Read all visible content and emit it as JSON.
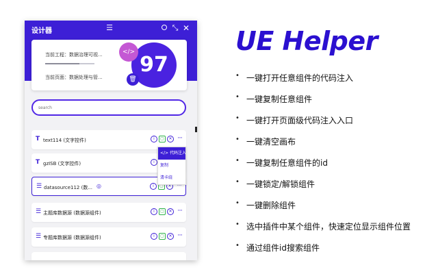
{
  "panel": {
    "title": "设计器",
    "icons": {
      "menu": "menu-icon",
      "circle": "circle-icon",
      "shrink": "shrink-icon",
      "close": "close-icon"
    },
    "info": {
      "project_label": "当前工程：数据治理可视...",
      "page_label": "当前页面：数据处理与管...",
      "progress": 0.7
    },
    "score": "97",
    "search_placeholder": "search",
    "components": [
      {
        "icon": "T",
        "label": "text114 (文字控件)"
      },
      {
        "icon": "T",
        "label": "gzISB (文字控件)"
      },
      {
        "icon": "database",
        "label": "datasource112 (数...",
        "selected": true
      },
      {
        "icon": "database",
        "label": "主题库数据源 (数据源组件)"
      },
      {
        "icon": "database",
        "label": "专题库数据源 (数据源组件)"
      }
    ],
    "context_menu": [
      "</> 代码注入",
      "复制",
      "清卡绕"
    ],
    "accent_color": "#3d1fd6"
  },
  "title": "UE Helper",
  "features": [
    "一键打开任意组件的代码注入",
    "一键复制任意组件",
    "一键打开页面级代码注入入口",
    "一键清空画布",
    "一键复制任意组件的id",
    "一键锁定/解锁组件",
    "一键删除组件",
    "选中插件中某个组件，快速定位显示组件位置",
    "通过组件id搜索组件"
  ],
  "bullet": "•"
}
